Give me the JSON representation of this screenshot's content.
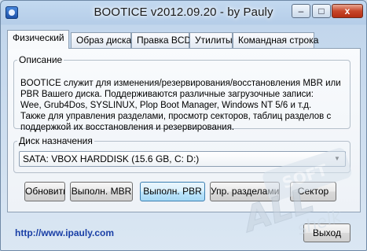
{
  "window": {
    "title": "BOOTICE v2012.09.20 - by Pauly"
  },
  "titlebar_controls": {
    "minimize": "–",
    "maximize": "□",
    "close": "x"
  },
  "tabs": [
    {
      "label": "Физический",
      "active": true
    },
    {
      "label": "Образ диска",
      "active": false
    },
    {
      "label": "Правка BCD",
      "active": false
    },
    {
      "label": "Утилиты",
      "active": false
    },
    {
      "label": "Командная строка",
      "active": false
    }
  ],
  "description": {
    "legend": "Описание",
    "text": "BOOTICE служит для изменения/резервирования/восстановления MBR или\nPBR Вашего диска. Поддерживаются различные загрузочные записи:\nWee, Grub4Dos, SYSLINUX, Plop Boot Manager, Windows NT 5/6 и т.д.\nТакже для управления разделами, просмотр секторов, таблиц разделов с\nподдержкой их восстановления и резервирования."
  },
  "target_disk": {
    "legend": "Диск назначения",
    "selected": "SATA: VBOX HARDDISK (15.6 GB, C: D:)"
  },
  "actions": {
    "refresh": "Обновить",
    "process_mbr": "Выполн. MBR",
    "process_pbr": "Выполн. PBR",
    "parts_manage": "Упр. разделами",
    "sector": "Сектор"
  },
  "footer": {
    "link": "http://www.ipauly.com",
    "exit": "Выход"
  },
  "watermark": {
    "brand": "ALL",
    "sub": "SOFT",
    "text": "shelk"
  },
  "colors": {
    "accent_selected": "#a7d9f5",
    "link": "#1a3fa6",
    "close_button": "#c7472a"
  }
}
